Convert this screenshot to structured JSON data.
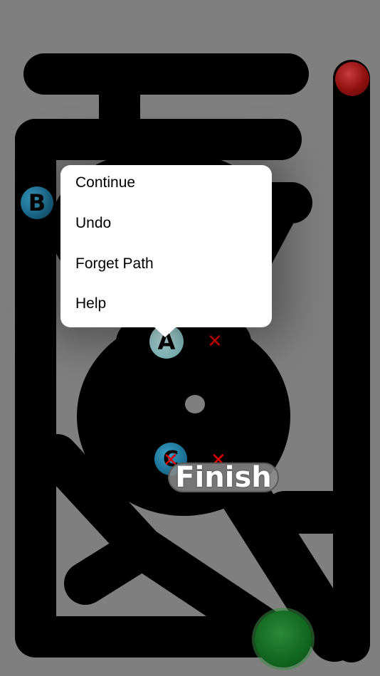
{
  "menu": {
    "items": [
      {
        "label": "Continue"
      },
      {
        "label": "Undo"
      },
      {
        "label": "Forget Path"
      },
      {
        "label": "Help"
      }
    ]
  },
  "markers": {
    "b": "B",
    "a": "A",
    "c": "C"
  },
  "x_mark": "✕",
  "finish_label": "Finish",
  "colors": {
    "background": "#7f7f7f",
    "path": "#000000",
    "start_ball": "#8e1010",
    "goal_ball": "#136a22",
    "x_mark": "#e00000"
  }
}
